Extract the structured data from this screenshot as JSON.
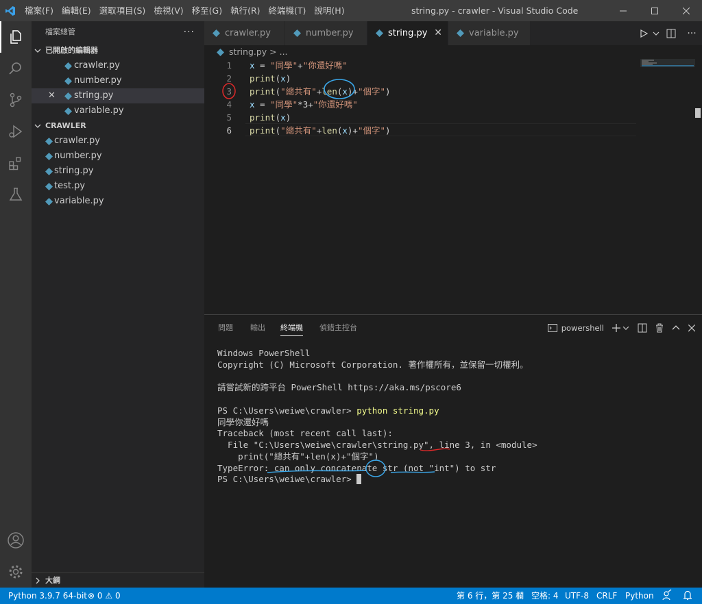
{
  "titlebar": {
    "menu": [
      "檔案(F)",
      "編輯(E)",
      "選取項目(S)",
      "檢視(V)",
      "移至(G)",
      "執行(R)",
      "終端機(T)",
      "說明(H)"
    ],
    "window_title": "string.py - crawler - Visual Studio Code"
  },
  "sidebar": {
    "header": "檔案總管",
    "open_editors_title": "已開啟的編輯器",
    "open_editors": [
      "crawler.py",
      "number.py",
      "string.py",
      "variable.py"
    ],
    "close_glyph": "✕",
    "folder_title": "CRAWLER",
    "files": [
      "crawler.py",
      "number.py",
      "string.py",
      "test.py",
      "variable.py"
    ],
    "outline_title": "大綱"
  },
  "tabs": [
    "crawler.py",
    "number.py",
    "string.py",
    "variable.py"
  ],
  "breadcrumb": "string.py > ...",
  "editor": {
    "line_numbers": [
      "1",
      "2",
      "3",
      "4",
      "5",
      "6"
    ],
    "lines": [
      [
        {
          "c": "v",
          "t": "x"
        },
        {
          "c": "p",
          "t": " = "
        },
        {
          "c": "s",
          "t": "\"同學\""
        },
        {
          "c": "p",
          "t": "+"
        },
        {
          "c": "s",
          "t": "\"你還好嗎\""
        }
      ],
      [
        {
          "c": "k",
          "t": "print"
        },
        {
          "c": "p",
          "t": "("
        },
        {
          "c": "v",
          "t": "x"
        },
        {
          "c": "p",
          "t": ")"
        }
      ],
      [
        {
          "c": "k",
          "t": "print"
        },
        {
          "c": "p",
          "t": "("
        },
        {
          "c": "s",
          "t": "\"總共有\""
        },
        {
          "c": "p",
          "t": "+"
        },
        {
          "c": "k",
          "t": "len"
        },
        {
          "c": "p",
          "t": "("
        },
        {
          "c": "v",
          "t": "x"
        },
        {
          "c": "p",
          "t": ")+"
        },
        {
          "c": "s",
          "t": "\"個字\""
        },
        {
          "c": "p",
          "t": ")"
        }
      ],
      [
        {
          "c": "v",
          "t": "x"
        },
        {
          "c": "p",
          "t": " = "
        },
        {
          "c": "s",
          "t": "\"同學\""
        },
        {
          "c": "p",
          "t": "*3+"
        },
        {
          "c": "s",
          "t": "\"你還好嗎\""
        }
      ],
      [
        {
          "c": "k",
          "t": "print"
        },
        {
          "c": "p",
          "t": "("
        },
        {
          "c": "v",
          "t": "x"
        },
        {
          "c": "p",
          "t": ")"
        }
      ],
      [
        {
          "c": "k",
          "t": "print"
        },
        {
          "c": "p",
          "t": "("
        },
        {
          "c": "s",
          "t": "\"總共有\""
        },
        {
          "c": "p",
          "t": "+"
        },
        {
          "c": "k",
          "t": "len"
        },
        {
          "c": "p",
          "t": "("
        },
        {
          "c": "v",
          "t": "x"
        },
        {
          "c": "p",
          "t": ")+"
        },
        {
          "c": "s",
          "t": "\"個字\""
        },
        {
          "c": "p",
          "t": ")"
        }
      ]
    ]
  },
  "panel": {
    "tabs": [
      "問題",
      "輸出",
      "終端機",
      "偵錯主控台"
    ],
    "terminal_name": "powershell",
    "lines": [
      "Windows PowerShell",
      "Copyright (C) Microsoft Corporation. 著作權所有，並保留一切權利。",
      "",
      "請嘗試新的跨平台 PowerShell https://aka.ms/pscore6",
      "",
      "",
      "同學你還好嗎",
      "Traceback (most recent call last):",
      "  File \"C:\\Users\\weiwe\\crawler\\string.py\", line 3, in <module>",
      "    print(\"總共有\"+len(x)+\"個字\")",
      "TypeError: can only concatenate str (not \"int\") to str",
      ""
    ],
    "prompt": "PS C:\\Users\\weiwe\\crawler>",
    "command": "python string.py"
  },
  "statusbar": {
    "interpreter": "Python 3.9.7 64-bit",
    "errors": "0",
    "warnings": "0",
    "position": "第 6 行，第 25 欄",
    "indent": "空格: 4",
    "encoding": "UTF-8",
    "eol": "CRLF",
    "language": "Python"
  },
  "colors": {
    "accent": "#007acc",
    "python_icon": "#519aba",
    "annotation_blue": "#3aa6e8",
    "annotation_red": "#e02a2a"
  }
}
